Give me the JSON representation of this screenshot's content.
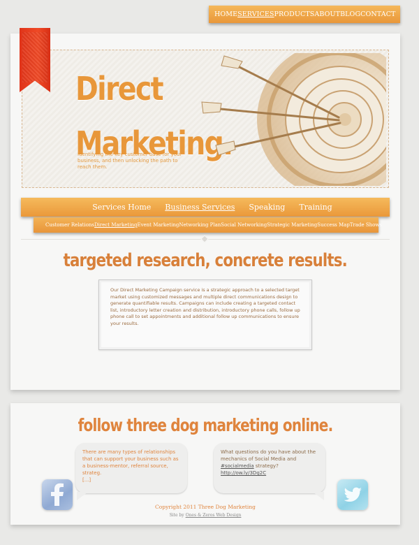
{
  "top_nav": [
    {
      "label": "HOME",
      "active": false
    },
    {
      "label": "SERVICES",
      "active": true
    },
    {
      "label": "PRODUCTS",
      "active": false
    },
    {
      "label": "ABOUT",
      "active": false
    },
    {
      "label": "BLOG",
      "active": false
    },
    {
      "label": "CONTACT",
      "active": false
    }
  ],
  "hero": {
    "title_line1": "Direct",
    "title_line2": "Marketing.",
    "subtitle": "Identifying the key customer base for your business, and then unlocking the path to reach them."
  },
  "services_nav": [
    {
      "label": "Services Home",
      "active": false
    },
    {
      "label": "Business Services",
      "active": true
    },
    {
      "label": "Speaking",
      "active": false
    },
    {
      "label": "Training",
      "active": false
    }
  ],
  "sub_nav": [
    {
      "label": "Customer Relations",
      "active": false
    },
    {
      "label": "Direct Marketing",
      "active": true
    },
    {
      "label": "Event Marketing",
      "active": false
    },
    {
      "label": "Networking Plan",
      "active": false
    },
    {
      "label": "Social Networking",
      "active": false
    },
    {
      "label": "Strategic Marketing",
      "active": false
    },
    {
      "label": "Success Map",
      "active": false
    },
    {
      "label": "Trade Shows",
      "active": false
    }
  ],
  "main": {
    "headline": "targeted research, concrete results.",
    "body": "Our Direct Marketing Campaign service is a strategic approach to a selected target market using customized messages and multiple direct communications design to generate quantifiable results. Campaigns can include creating a targeted contact list, introductory letter creation and distribution, introductory phone calls, follow up phone call to set appointments and additional follow up communications to ensure your results."
  },
  "footer": {
    "headline": "follow three dog marketing online.",
    "facebook_post": "There are many types of relationships that can support your business such as a business-mentor, referral source, strateg.",
    "facebook_more": "[...]",
    "twitter_post_prefix": "What questions do you have about the mechanics of Social Media and",
    "twitter_hashtag": "#socialmedia",
    "twitter_post_mid": "strategy?",
    "twitter_link": "http://ow.ly/3Dg2C",
    "copyright": "Copyright 2011 Three Dog Marketing",
    "credit_prefix": "Site by",
    "credit_link": "Ones & Zeros Web Design"
  },
  "colors": {
    "accent_orange": "#e9973a",
    "ribbon_red": "#e0341a",
    "page_bg": "#e9e9e7"
  }
}
